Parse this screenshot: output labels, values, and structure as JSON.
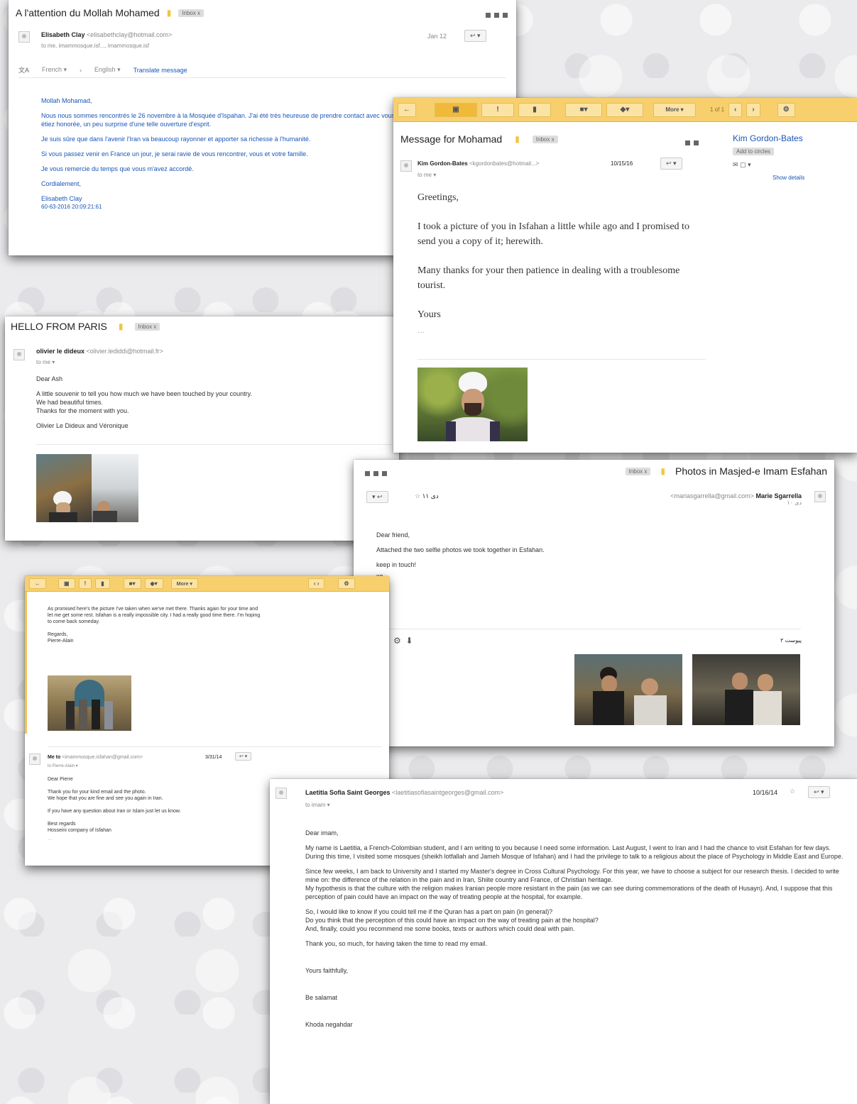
{
  "w1": {
    "subject": "A l'attention du Mollah Mohamed",
    "label": "Inbox x",
    "sender_name": "Elisabeth Clay",
    "sender_email": "<elisabethclay@hotmail.com>",
    "recipients": "to me, imammosque.isf..., imammosque.isf",
    "date": "Jan 12",
    "translate": {
      "from": "French ▾",
      "to": "English ▾",
      "link": "Translate message"
    },
    "body": [
      "Mollah Mohamad,",
      "Nous nous sommes rencontrés le 26 novembre à la Mosquée d'Ispahan. J'ai été très heureuse de prendre contact avec vous, et vous étiez honorée, un peu surprise d'une telle ouverture d'esprit.",
      "Je suis sûre que dans l'avenir l'Iran va beaucoup rayonner et apporter sa richesse à l'humanité.",
      "Si vous passez venir en France un jour, je serai ravie de vous rencontrer, vous et votre famille.",
      "Je vous remercie du temps que vous m'avez accordé.",
      "Cordialement,",
      "Elisabeth Clay",
      "60-63-2016 20:09:21:61"
    ]
  },
  "w2": {
    "toolbar": {
      "more": "More ▾",
      "page": "1 of 1"
    },
    "subject": "Message for Mohamad",
    "label": "Inbox x",
    "sender_name": "Kim Gordon-Bates",
    "sender_email": "<kgordonbates@hotmail...>",
    "recipient": "to me ▾",
    "date": "10/15/16",
    "side_name": "Kim Gordon-Bates",
    "side_add": "Add to circles",
    "side_show": "Show details",
    "body": [
      "Greetings,",
      "I took a picture of you in Isfahan a little while ago and I promised to send you a copy of it; herewith.",
      "Many thanks for your then patience in dealing with a troublesome tourist.",
      "Yours",
      "…"
    ]
  },
  "w3": {
    "subject": "HELLO FROM PARIS",
    "label": "Inbox x",
    "sender_name": "olivier le dideux",
    "sender_email": "<olivier.lediddi@hotmail.fr>",
    "recipient": "to me ▾",
    "body": [
      "Dear Ash",
      "A little souvenir to tell you how much we have been touched by your country.\nWe had beautiful times.\nThanks for the moment with you.",
      "Olivier Le Dideux and Véronique"
    ]
  },
  "w4": {
    "label": "Inbox x",
    "subject": "Photos in Masjed-e Imam Esfahan",
    "sender_name": "Marie Sgarrella",
    "sender_email": "<mariasgarrella@gmail.com>",
    "date": "۱۱ دی",
    "sub_date": "۱۰ دی",
    "attach_count": "۲ پیوست",
    "body": [
      "Dear friend,",
      "Attached the two selfie photos we took together in Esfahan.",
      "keep in touch!",
      "xo",
      "x"
    ]
  },
  "w5": {
    "toolbar": {
      "more": "More ▾"
    },
    "body1": [
      "As promised here's the picture I've taken when we've met there. Thanks again for your time and let me get some rest. Isfahan is a really impossible city. I had a really good time there. I'm hoping to come back someday.",
      "Regards,\nPierre-Alain"
    ],
    "sender_name": "Me to",
    "sender_email": "<imammosque.isfahan@gmail.com>",
    "recipient": "to Pierre-Alain ▾",
    "date": "3/31/14",
    "body2": [
      "Dear Pierre",
      "Thank you for your kind email and the photo.\nWe hope that you are fine and see you again in Iran.",
      "If you have any question about Iran or Islam just let us know.",
      "Best regards\nHosseini company of Isfahan",
      "…"
    ]
  },
  "w6": {
    "sender_name": "Laetitia Sofia Saint Georges",
    "sender_email": "<laetitiasofiasaintgeorges@gmail.com>",
    "recipient": "to imam ▾",
    "date": "10/16/14",
    "body": [
      "Dear imam,",
      "My name is Laetitia, a French-Colombian student, and I am writing to you because I need some information. Last August, I went to Iran and I had the chance to visit Esfahan for few days. During this time, I visited some mosques (sheikh lotfallah and Jameh Mosque of Isfahan) and I had the privilege to talk to a religious about the place of Psychology in Middle East and Europe.",
      "Since few weeks, I am back to University and I started my Master's degree in Cross Cultural Psychology. For this year, we have to choose a subject for our research thesis. I decided to write mine on: the difference of the relation in the pain and in Iran, Shiite country and France, of Christian heritage.\nMy hypothesis is that the culture with the religion makes Iranian people more resistant in the pain (as we can see during commemorations of the death of Husayn). And, I suppose that this perception of pain could have an impact on the way of treating people at the hospital, for example.",
      "So, I would like to know if you could tell me if the Quran has a part on pain (in general)?\nDo you think that the perception of this could have an impact on the way of treating pain at the hospital?\nAnd, finally, could you recommend me some books, texts or authors which could deal with pain.",
      "Thank you, so much, for having taken the time to read my email.",
      "Yours faithfully,",
      "Be salamat",
      "Khoda negahdar"
    ]
  }
}
